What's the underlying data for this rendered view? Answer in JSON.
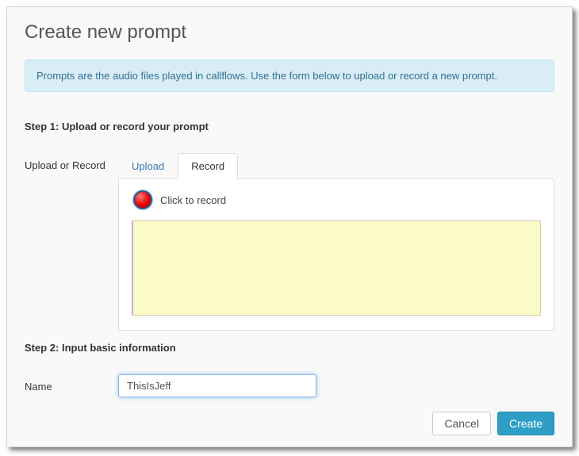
{
  "title": "Create new prompt",
  "info_text": "Prompts are the audio files played in callflows. Use the form below to upload or record a new prompt.",
  "step1": {
    "heading": "Step 1: Upload or record your prompt",
    "row_label": "Upload or Record",
    "tabs": {
      "upload": "Upload",
      "record": "Record"
    },
    "record_label": "Click to record"
  },
  "step2": {
    "heading": "Step 2: Input basic information",
    "name_label": "Name",
    "name_value": "ThisIsJeff"
  },
  "buttons": {
    "cancel": "Cancel",
    "create": "Create"
  }
}
